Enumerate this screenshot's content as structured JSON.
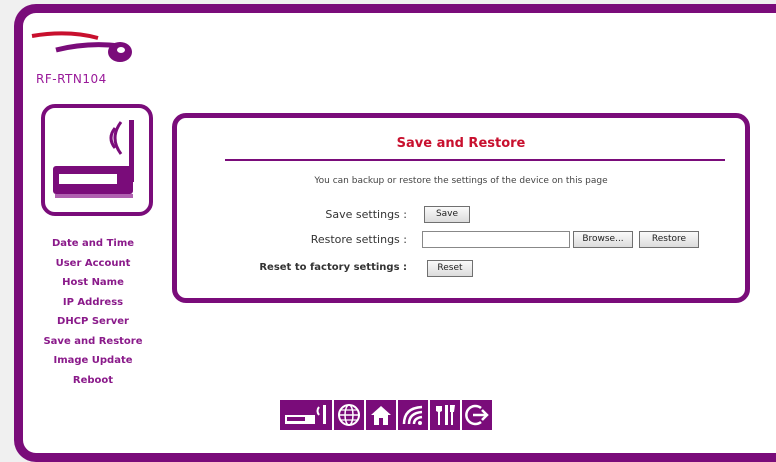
{
  "brand": {
    "model": "RF-RTN104",
    "logo_icon": "router-logo-icon",
    "device_icon": "wireless-router-icon"
  },
  "sidebar": {
    "items": [
      {
        "label": "Date and Time"
      },
      {
        "label": "User Account"
      },
      {
        "label": "Host Name"
      },
      {
        "label": "IP Address"
      },
      {
        "label": "DHCP Server"
      },
      {
        "label": "Save and Restore"
      },
      {
        "label": "Image Update"
      },
      {
        "label": "Reboot"
      }
    ]
  },
  "panel": {
    "title": "Save and Restore",
    "description": "You can backup or restore the settings of the device on this page",
    "save": {
      "label": "Save settings :",
      "button": "Save"
    },
    "restore": {
      "label": "Restore settings :",
      "file_value": "",
      "browse_button": "Browse...",
      "restore_button": "Restore"
    },
    "reset": {
      "label": "Reset to factory settings :",
      "button": "Reset"
    }
  },
  "bottom_nav": {
    "icons": [
      "status-icon",
      "internet-icon",
      "home-network-icon",
      "wireless-icon",
      "tools-icon",
      "logout-icon"
    ]
  },
  "colors": {
    "frame": "#7a0c7a",
    "title": "#c8102e",
    "nav_text": "#8a1a8a"
  }
}
